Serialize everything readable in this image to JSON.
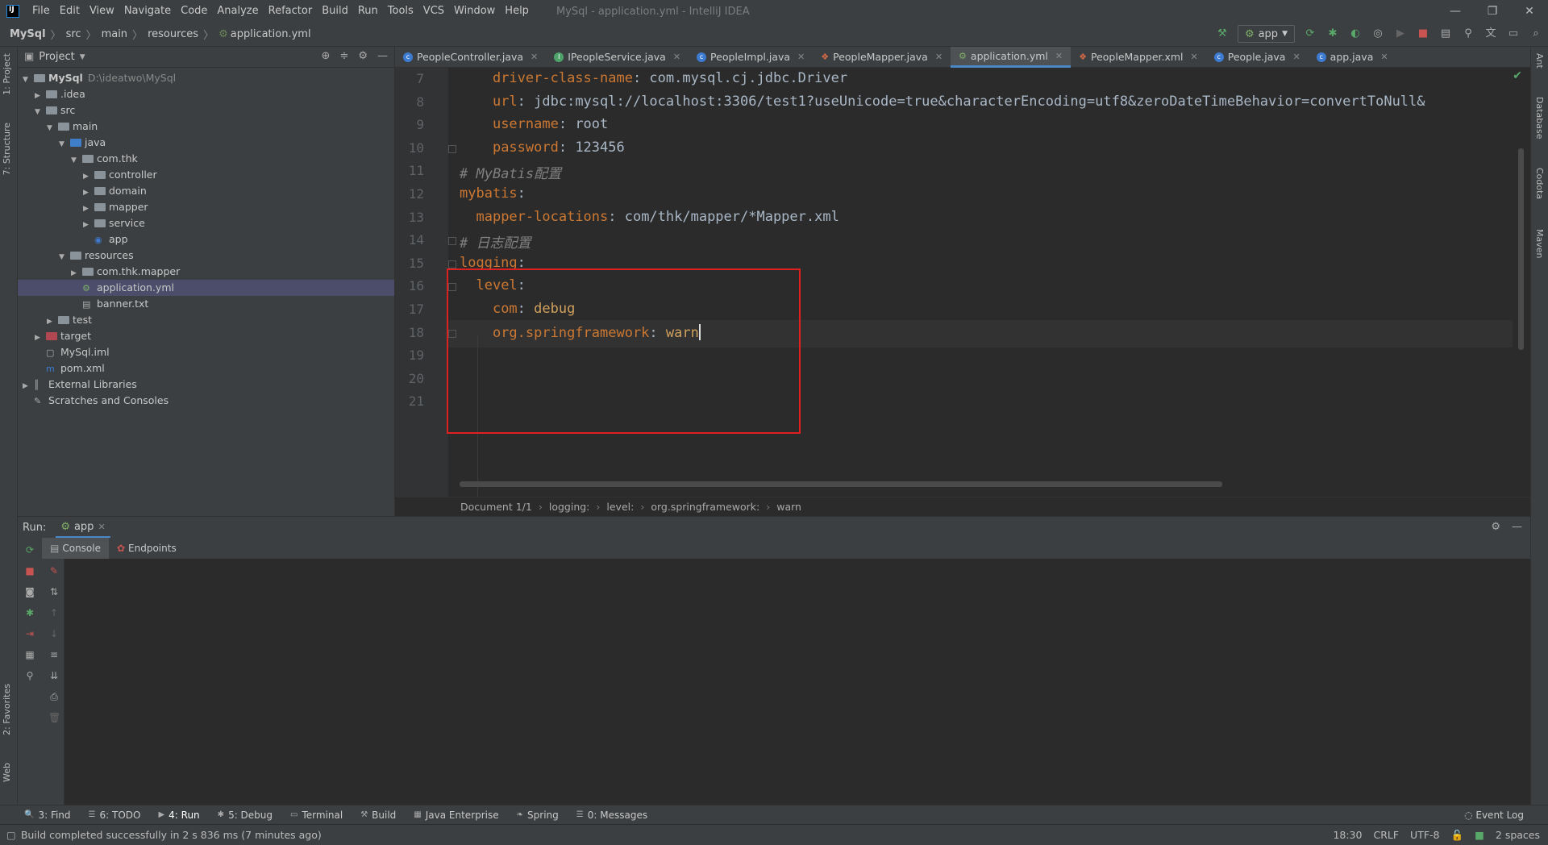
{
  "menu": {
    "items": [
      "File",
      "Edit",
      "View",
      "Navigate",
      "Code",
      "Analyze",
      "Refactor",
      "Build",
      "Run",
      "Tools",
      "VCS",
      "Window",
      "Help"
    ],
    "window_title": "MySql - application.yml - IntelliJ IDEA"
  },
  "navbar": {
    "crumbs": [
      "MySql",
      "src",
      "main",
      "resources",
      "application.yml"
    ],
    "run_config": "app"
  },
  "left_stripe": {
    "project": "1: Project",
    "structure": "7: Structure",
    "favorites": "2: Favorites",
    "web": "Web"
  },
  "right_stripe": {
    "ant": "Ant",
    "database": "Database",
    "codota": "Codota",
    "maven": "Maven"
  },
  "project": {
    "title": "Project",
    "root_name": "MySql",
    "root_path": "D:\\ideatwo\\MySql",
    "tree": [
      {
        "label": "MySql",
        "depth": 0,
        "arrow": "▼",
        "type": "root"
      },
      {
        "label": ".idea",
        "depth": 1,
        "arrow": "▶",
        "type": "folder"
      },
      {
        "label": "src",
        "depth": 1,
        "arrow": "▼",
        "type": "folder"
      },
      {
        "label": "main",
        "depth": 2,
        "arrow": "▼",
        "type": "folder"
      },
      {
        "label": "java",
        "depth": 3,
        "arrow": "▼",
        "type": "folder-blue"
      },
      {
        "label": "com.thk",
        "depth": 4,
        "arrow": "▼",
        "type": "folder"
      },
      {
        "label": "controller",
        "depth": 5,
        "arrow": "▶",
        "type": "folder"
      },
      {
        "label": "domain",
        "depth": 5,
        "arrow": "▶",
        "type": "folder"
      },
      {
        "label": "mapper",
        "depth": 5,
        "arrow": "▶",
        "type": "folder"
      },
      {
        "label": "service",
        "depth": 5,
        "arrow": "▶",
        "type": "folder"
      },
      {
        "label": "app",
        "depth": 5,
        "arrow": "",
        "type": "class"
      },
      {
        "label": "resources",
        "depth": 3,
        "arrow": "▼",
        "type": "folder-res"
      },
      {
        "label": "com.thk.mapper",
        "depth": 4,
        "arrow": "▶",
        "type": "folder"
      },
      {
        "label": "application.yml",
        "depth": 4,
        "arrow": "",
        "type": "yml",
        "selected": true
      },
      {
        "label": "banner.txt",
        "depth": 4,
        "arrow": "",
        "type": "txt"
      },
      {
        "label": "test",
        "depth": 2,
        "arrow": "▶",
        "type": "folder"
      },
      {
        "label": "target",
        "depth": 1,
        "arrow": "▶",
        "type": "folder-red"
      },
      {
        "label": "MySql.iml",
        "depth": 1,
        "arrow": "",
        "type": "iml"
      },
      {
        "label": "pom.xml",
        "depth": 1,
        "arrow": "",
        "type": "pom"
      },
      {
        "label": "External Libraries",
        "depth": 0,
        "arrow": "▶",
        "type": "lib"
      },
      {
        "label": "Scratches and Consoles",
        "depth": 0,
        "arrow": "",
        "type": "scratch"
      }
    ]
  },
  "tabs": [
    {
      "label": "PeopleController.java",
      "icon": "c"
    },
    {
      "label": "IPeopleService.java",
      "icon": "i"
    },
    {
      "label": "PeopleImpl.java",
      "icon": "c"
    },
    {
      "label": "PeopleMapper.java",
      "icon": "x"
    },
    {
      "label": "application.yml",
      "icon": "y",
      "active": true
    },
    {
      "label": "PeopleMapper.xml",
      "icon": "x"
    },
    {
      "label": "People.java",
      "icon": "c"
    },
    {
      "label": "app.java",
      "icon": "c",
      "no_close": false
    }
  ],
  "editor": {
    "lines": [
      {
        "n": "7",
        "parts": [
          {
            "t": "    "
          },
          {
            "t": "driver-class-name",
            "c": "key"
          },
          {
            "t": ": com.mysql.cj.jdbc.Driver"
          }
        ]
      },
      {
        "n": "8",
        "parts": [
          {
            "t": "    "
          },
          {
            "t": "url",
            "c": "key"
          },
          {
            "t": ": jdbc:mysql://localhost:3306/test1?useUnicode=true&characterEncoding=utf8&zeroDateTimeBehavior=convertToNull&"
          }
        ]
      },
      {
        "n": "9",
        "parts": [
          {
            "t": "    "
          },
          {
            "t": "username",
            "c": "key"
          },
          {
            "t": ": root"
          }
        ]
      },
      {
        "n": "10",
        "parts": [
          {
            "t": "    "
          },
          {
            "t": "password",
            "c": "key"
          },
          {
            "t": ": 123456"
          }
        ]
      },
      {
        "n": "11",
        "parts": [
          {
            "t": "# MyBatis配置",
            "c": "cmt"
          }
        ]
      },
      {
        "n": "12",
        "parts": [
          {
            "t": "mybatis",
            "c": "key"
          },
          {
            "t": ":"
          }
        ]
      },
      {
        "n": "13",
        "parts": [
          {
            "t": "  "
          },
          {
            "t": "mapper-locations",
            "c": "key"
          },
          {
            "t": ": com/thk/mapper/*Mapper.xml"
          }
        ]
      },
      {
        "n": "14",
        "parts": [
          {
            "t": "# 日志配置",
            "c": "cmt"
          }
        ]
      },
      {
        "n": "15",
        "parts": [
          {
            "t": "logging",
            "c": "key"
          },
          {
            "t": ":"
          }
        ]
      },
      {
        "n": "16",
        "parts": [
          {
            "t": "  "
          },
          {
            "t": "level",
            "c": "key"
          },
          {
            "t": ":"
          }
        ]
      },
      {
        "n": "17",
        "parts": [
          {
            "t": "    "
          },
          {
            "t": "com",
            "c": "key"
          },
          {
            "t": ": "
          },
          {
            "t": "debug",
            "c": "strv"
          }
        ]
      },
      {
        "n": "18",
        "parts": [
          {
            "t": "    "
          },
          {
            "t": "org.springframework",
            "c": "key"
          },
          {
            "t": ": "
          },
          {
            "t": "warn",
            "c": "strv"
          }
        ],
        "caret": true
      },
      {
        "n": "19",
        "parts": []
      },
      {
        "n": "20",
        "parts": []
      },
      {
        "n": "21",
        "parts": []
      }
    ]
  },
  "breadcrumb": [
    "Document 1/1",
    "logging:",
    "level:",
    "org.springframework:",
    "warn"
  ],
  "run_panel": {
    "title": "Run:",
    "tab": "app",
    "subtabs": [
      "Console",
      "Endpoints"
    ]
  },
  "bottom_tabs": [
    {
      "label": "3: Find",
      "icon": "🔍"
    },
    {
      "label": "6: TODO",
      "icon": "☰"
    },
    {
      "label": "4: Run",
      "icon": "▶",
      "active": true
    },
    {
      "label": "5: Debug",
      "icon": "✱"
    },
    {
      "label": "Terminal",
      "icon": "▭"
    },
    {
      "label": "Build",
      "icon": "⚒"
    },
    {
      "label": "Java Enterprise",
      "icon": "▦"
    },
    {
      "label": "Spring",
      "icon": "❧"
    },
    {
      "label": "0: Messages",
      "icon": "☰"
    }
  ],
  "event_log": "Event Log",
  "status": {
    "message": "Build completed successfully in 2 s 836 ms (7 minutes ago)",
    "position": "18:30",
    "line_sep": "CRLF",
    "encoding": "UTF-8",
    "indent": "2 spaces"
  }
}
